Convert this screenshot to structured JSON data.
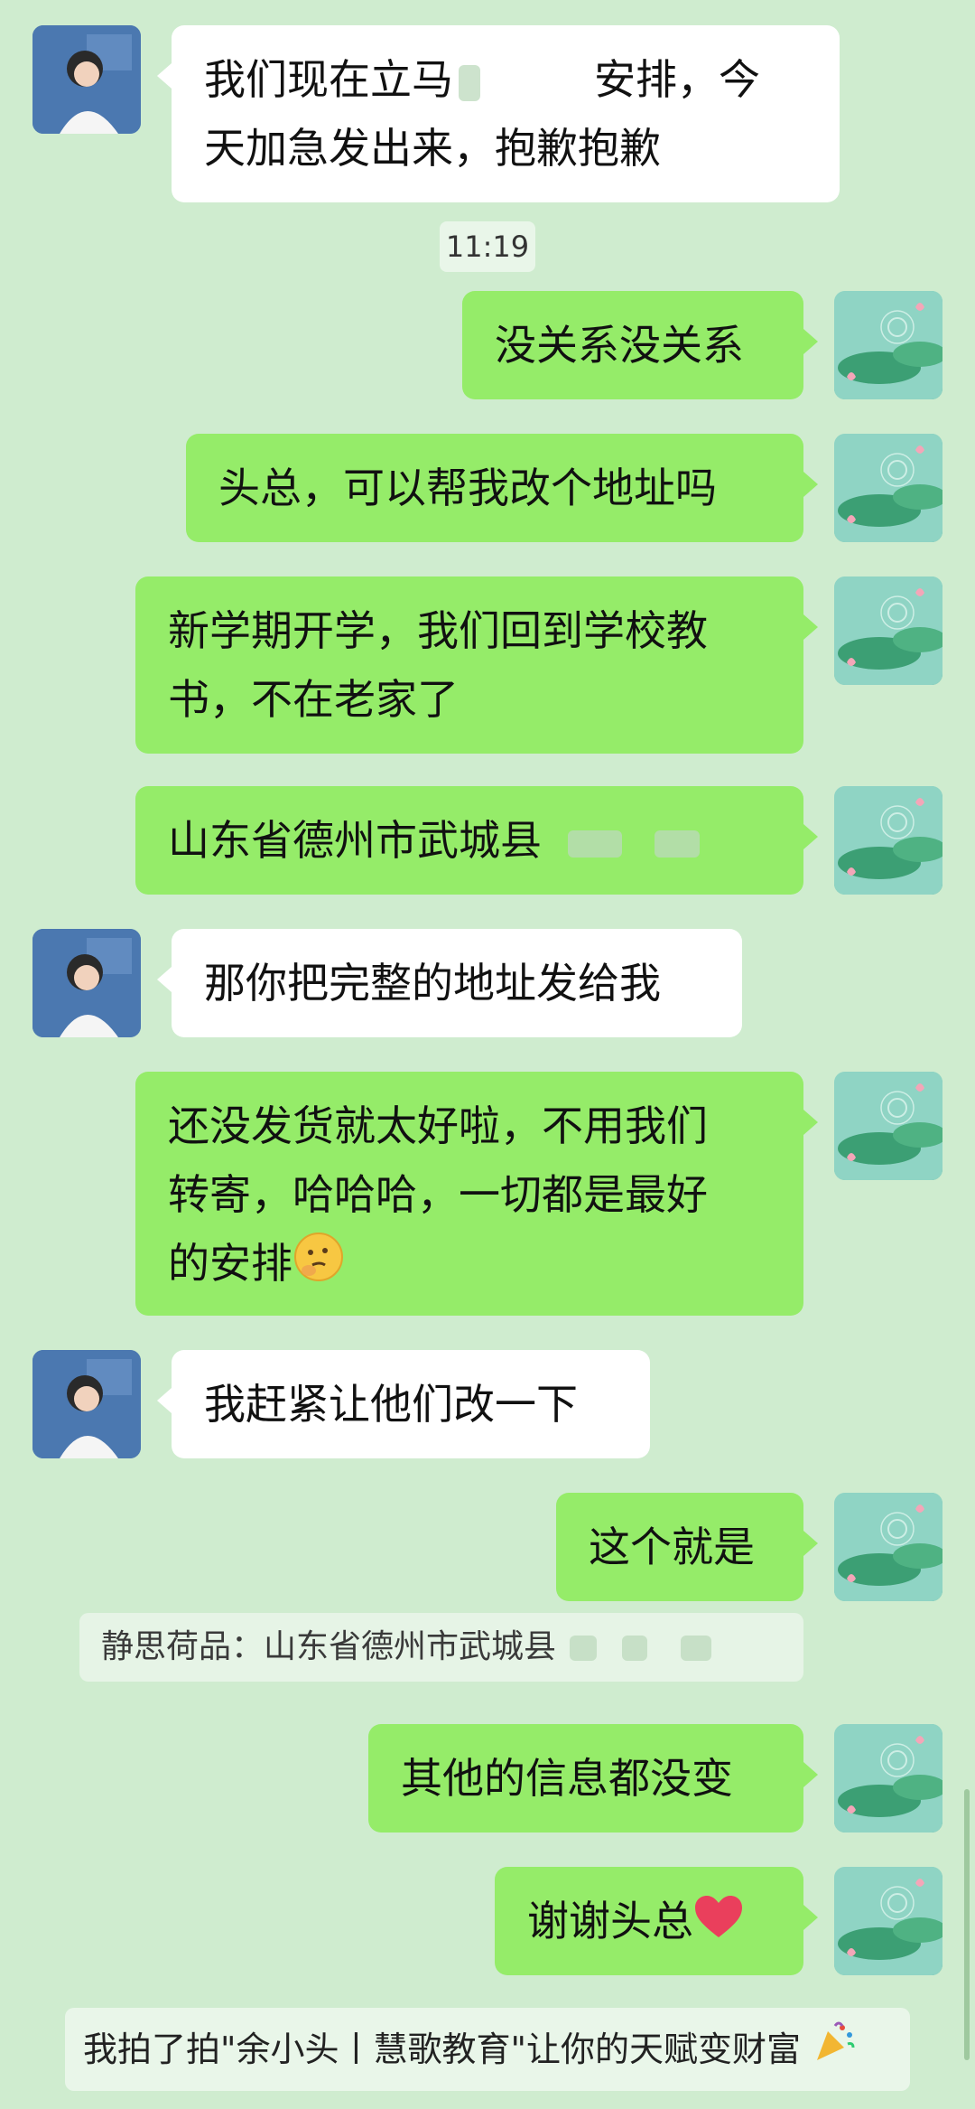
{
  "messages": [
    {
      "side": "left",
      "text": "我们现在立马",
      "text2": "安排，今",
      "text3": "天加急发出来，抱歉抱歉"
    },
    {
      "timestamp": "11:19"
    },
    {
      "side": "right",
      "text": "没关系没关系"
    },
    {
      "side": "right",
      "text": "头总，可以帮我改个地址吗"
    },
    {
      "side": "right",
      "text": "新学期开学，我们回到学校教",
      "text2": "书，不在老家了"
    },
    {
      "side": "right",
      "text": "山东省德州市武城县"
    },
    {
      "side": "left",
      "text": "那你把完整的地址发给我"
    },
    {
      "side": "right",
      "text": "还没发货就太好啦，不用我们",
      "text2": "转寄，哈哈哈，一切都是最好",
      "text3": "的安排"
    },
    {
      "side": "left",
      "text": "我赶紧让他们改一下"
    },
    {
      "side": "right",
      "text": "这个就是"
    },
    {
      "quote": "静思荷品：山东省德州市武城县"
    },
    {
      "side": "right",
      "text": "其他的信息都没变"
    },
    {
      "side": "right",
      "text": "谢谢头总"
    }
  ],
  "pat": "我拍了拍\"余小头丨慧歌教育\"让你的天赋变财富",
  "icons": {
    "left_avatar": "avatar-woman-icon",
    "right_avatar": "lotus-pond-avatar-icon",
    "emoji_think": "thinking-emoji-icon",
    "emoji_heart": "heart-emoji-icon",
    "emoji_party": "party-popper-emoji-icon"
  },
  "colors": {
    "background": "#cfeccf",
    "bubble_right": "#95ec69",
    "bubble_left": "#ffffff"
  }
}
